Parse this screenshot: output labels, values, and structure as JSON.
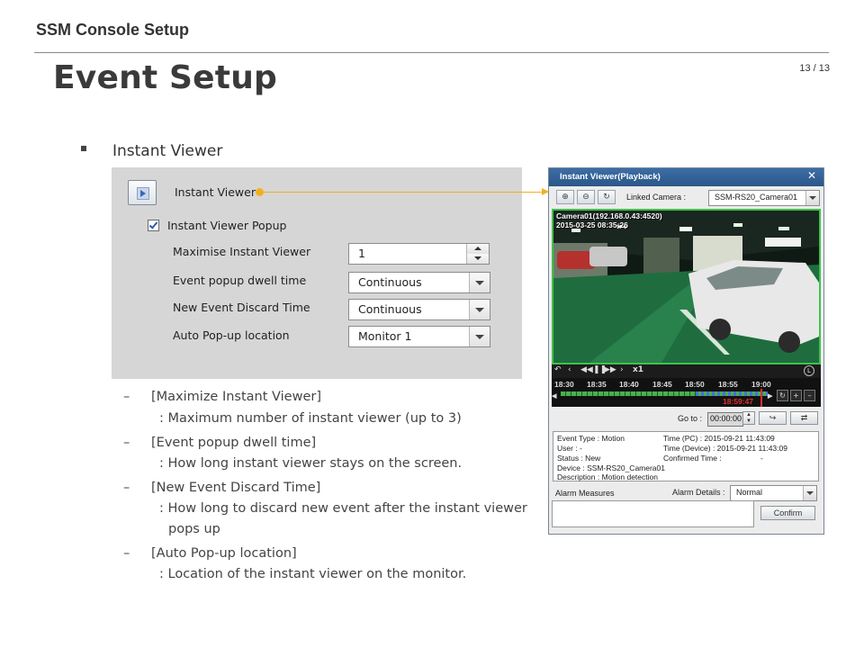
{
  "header": {
    "section": "SSM Console Setup",
    "page_number": "13 / 13"
  },
  "page_title": "Event Setup",
  "section_label": "Instant Viewer",
  "settings": {
    "title": "Instant Viewer",
    "popup_checkbox_label": "Instant Viewer Popup",
    "popup_checked": true,
    "rows": [
      {
        "label": "Maximise Instant Viewer",
        "value": "1"
      },
      {
        "label": "Event popup dwell time",
        "value": "Continuous"
      },
      {
        "label": "New Event Discard Time",
        "value": "Continuous"
      },
      {
        "label": "Auto Pop-up location",
        "value": "Monitor 1"
      }
    ]
  },
  "descriptions": [
    {
      "title": "[Maximize Instant Viewer]",
      "lines": [
        ": Maximum number of instant viewer (up to 3)"
      ]
    },
    {
      "title": "[Event popup dwell time]",
      "lines": [
        ": How long instant viewer stays on the screen."
      ]
    },
    {
      "title": "[New Event Discard Time]",
      "lines": [
        ": How long to discard new event after the instant viewer",
        "pops up"
      ]
    },
    {
      "title": "[Auto Pop-up location]",
      "lines": [
        ": Location of the instant viewer on the monitor."
      ]
    }
  ],
  "viewer": {
    "title": "Instant Viewer(Playback)",
    "close": "✕",
    "linked_camera_label": "Linked Camera :",
    "linked_camera_value": "SSM-RS20_Camera01",
    "osd_line1": "Camera01(192.168.0.43:4520)",
    "osd_line2": "2015-03-25 08:35:26",
    "speed": "x1",
    "live_badge": "L",
    "timeline_ticks": [
      "18:30",
      "18:35",
      "18:40",
      "18:45",
      "18:50",
      "18:55",
      "19:00"
    ],
    "current_time": "18:59:47",
    "goto_label": "Go to :",
    "goto_value": "00:00:00",
    "event": {
      "event_type": "Event Type : Motion",
      "user": "User : -",
      "status": "Status : New",
      "device": "Device : SSM-RS20_Camera01",
      "description": "Description : Motion detection",
      "time_pc": "Time (PC) : 2015-09-21 11:43:09",
      "time_device": "Time (Device) : 2015-09-21 11:43:09",
      "confirmed_time_label": "Confirmed Time :",
      "confirmed_time_value": "-"
    },
    "alarm_measures_label": "Alarm Measures",
    "alarm_details_label": "Alarm Details :",
    "alarm_details_value": "Normal",
    "confirm_button": "Confirm"
  },
  "colors": {
    "accent_connector": "#f2b01e",
    "title_bar": "#2b5688",
    "video_border": "#41c14b",
    "timeline_cursor": "#e23030"
  }
}
